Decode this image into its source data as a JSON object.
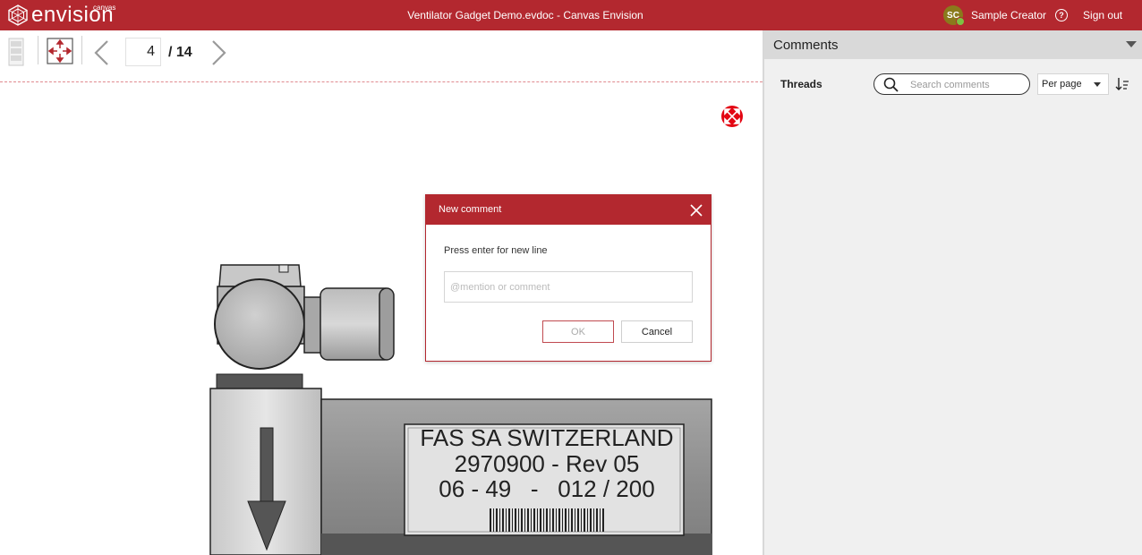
{
  "header": {
    "brand": "envision",
    "brand_sup": "canvas",
    "title": "Ventilator Gadget Demo.evdoc - Canvas Envision",
    "user_initials": "SC",
    "user_name": "Sample Creator",
    "help": "?",
    "sign_out": "Sign out"
  },
  "toolbar": {
    "page_current": "4",
    "page_total": "/ 14"
  },
  "drawing": {
    "label_lines": [
      "FAS SA SWITZERLAND",
      "2970900 - Rev 05",
      "06 - 49   -   012 / 200"
    ]
  },
  "comments": {
    "title": "Comments",
    "threads_label": "Threads",
    "search_placeholder": "Search comments",
    "per_page_label": "Per page"
  },
  "dialog": {
    "title": "New comment",
    "hint": "Press enter for new line",
    "input_placeholder": "@mention or comment",
    "ok_label": "OK",
    "cancel_label": "Cancel"
  },
  "colors": {
    "brand_red": "#b3282f",
    "avatar": "#8a7a1c",
    "status_online": "#7dc242"
  }
}
